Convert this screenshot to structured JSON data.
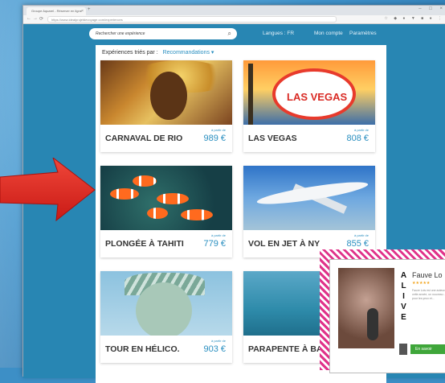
{
  "browser": {
    "tab_title": "Groupe Aquarel - Réserver en ligne",
    "tab_close": "×",
    "new_tab": "+",
    "window_controls": "– □ ×",
    "url": "https://www.idealprojetdevoyage.com/experiences",
    "nav_back": "←",
    "nav_forward": "→",
    "nav_reload": "⟳",
    "extensions": "☆ ◆ ● ▼ ■ ● ⋮"
  },
  "header": {
    "search_placeholder": "Rechercher une expérience",
    "search_icon": "🔍",
    "languages": "Langues : FR",
    "account": "Mon compte",
    "settings": "Paramètres"
  },
  "sort": {
    "label": "Expériences triés par :",
    "value": "Recommandations"
  },
  "cards": [
    {
      "title": "CARNAVAL DE RIO",
      "from": "à partir de",
      "price": "989 €"
    },
    {
      "title": "LAS VEGAS",
      "from": "à partir de",
      "price": "808 €",
      "sign": "LAS VEGAS"
    },
    {
      "title": "PLONGÉE À TAHITI",
      "from": "à partir de",
      "price": "779 €"
    },
    {
      "title": "VOL EN JET À NY",
      "from": "à partir de",
      "price": "855 €"
    },
    {
      "title": "TOUR EN HÉLICO.",
      "from": "à partir de",
      "price": "903 €"
    },
    {
      "title": "PARAPENTE À BA"
    }
  ],
  "ad": {
    "vertical_text": "ALIVE",
    "name": "Fauve Lo",
    "stars": "★★★★★",
    "description": "Fauve Lois est une auteure... cette année, un nouveau ... pour les yeux et...",
    "cta": "En savoir"
  },
  "colors": {
    "accent": "#2a8fc0",
    "site_bg": "#2886b3",
    "arrow": "#e32b22",
    "ad_stripe": "#e0338a"
  }
}
